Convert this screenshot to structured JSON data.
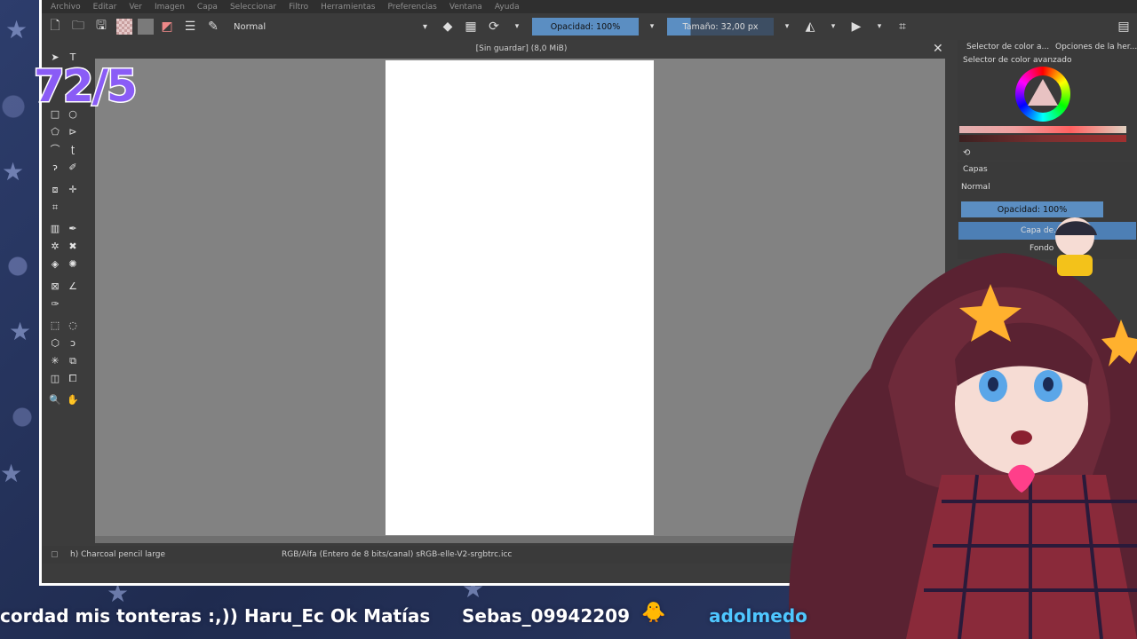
{
  "menu": [
    "Archivo",
    "Editar",
    "Ver",
    "Imagen",
    "Capa",
    "Seleccionar",
    "Filtro",
    "Herramientas",
    "Preferencias",
    "Ventana",
    "Ayuda"
  ],
  "toolbar": {
    "blend_mode": "Normal",
    "opacity": "Opacidad: 100%",
    "size": "Tamaño: 32,00 px"
  },
  "document": {
    "title": "[Sin guardar]  (8,0 MiB)"
  },
  "status": {
    "brush": "h) Charcoal pencil large",
    "color_profile": "RGB/Alfa (Entero de 8 bits/canal)  sRGB-elle-V2-srgbtrc.icc"
  },
  "dockers": {
    "tab1": "Selector de color a...",
    "tab2": "Opciones de la her...",
    "color_title": "Selector de color avanzado",
    "layers_title": "Capas",
    "layers_blend": "Normal",
    "layers_opacity": "Opacidad:  100%",
    "layers": [
      "Capa de...",
      "Fondo"
    ]
  },
  "overlay": {
    "counter": "72/5"
  },
  "chat": [
    {
      "text": "cordad mis tonteras :,))"
    },
    {
      "text": "Haru_Ec Ok Matías"
    },
    {
      "text": "Sebas_09942209"
    },
    {
      "text": "adolmedo"
    }
  ],
  "colors": {
    "accent": "#5b8ec2",
    "counter": "#8a5cf6",
    "chat_cyan": "#4fc7ff"
  }
}
